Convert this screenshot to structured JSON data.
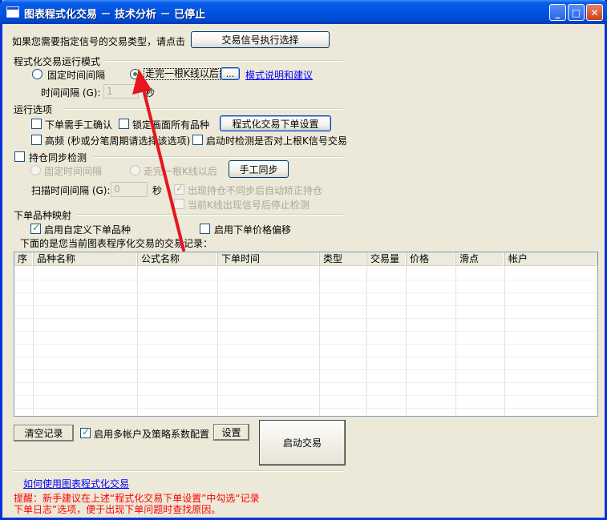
{
  "window": {
    "title": "图表程式化交易 － 技术分析 － 已停止",
    "min_icon": "minimize-icon",
    "max_icon": "maximize-icon",
    "close_icon": "close-icon"
  },
  "signal": {
    "prompt": "如果您需要指定信号的交易类型，请点击",
    "button": "交易信号执行选择"
  },
  "mode": {
    "group_title": "程式化交易运行模式",
    "radio_fixed": "固定时间间隔",
    "radio_fixed_checked": false,
    "radio_kline": "走完一根K线以后",
    "radio_kline_checked": true,
    "more_button": "...",
    "explain_link": "模式说明和建议",
    "interval_label": "时间间隔 (G):",
    "interval_value": "1",
    "interval_unit": "秒"
  },
  "run_options": {
    "group_title": "运行选项",
    "manual_confirm": "下单需手工确认",
    "manual_confirm_checked": false,
    "lock_chart": "锁定画面所有品种",
    "lock_chart_checked": false,
    "order_settings_button": "程式化交易下单设置",
    "high_freq": "高频 (秒或分笔周期请选择该选项)",
    "high_freq_checked": false,
    "startup_check": "启动时检测是否对上根K信号交易",
    "startup_check_checked": false
  },
  "position_sync": {
    "group_title": "持仓同步检测",
    "enabled": false,
    "radio_fixed": "固定时间间隔",
    "radio_kline": "走完一根K线以后",
    "manual_sync_button": "手工同步",
    "scan_label": "扫描时间间隔 (G):",
    "scan_value": "0",
    "scan_unit": "秒",
    "auto_correct": "出现持仓不同步后自动矫正持仓",
    "auto_correct_checked": true,
    "stop_check": "当前K线出现信号后停止检测",
    "stop_check_checked": false
  },
  "mapping": {
    "group_title": "下单品种映射",
    "custom_symbol": "启用自定义下单品种",
    "custom_symbol_checked": true,
    "price_offset": "启用下单价格偏移",
    "price_offset_checked": false,
    "records_caption": "下面的是您当前图表程序化交易的交易记录："
  },
  "records_table": {
    "columns": [
      "序",
      "品种名称",
      "公式名称",
      "下单时间",
      "类型",
      "交易量",
      "价格",
      "滑点",
      "帐户"
    ],
    "rows": []
  },
  "footer": {
    "clear_button": "清空记录",
    "multi_account": "启用多帐户及策略系数配置",
    "multi_account_checked": true,
    "settings_button": "设置",
    "start_button": "启动交易",
    "help_link": "如何使用图表程式化交易",
    "tip_line1": "提醒：新手建议在上述“程式化交易下单设置”中勾选“记录",
    "tip_line2": "下单日志”选项，便于出现下单问题时查找原因。"
  },
  "colors": {
    "title_blue": "#0054e3",
    "tip_red": "#ff0000",
    "link_blue": "#0000ff",
    "annotation_arrow": "#e8141e"
  }
}
